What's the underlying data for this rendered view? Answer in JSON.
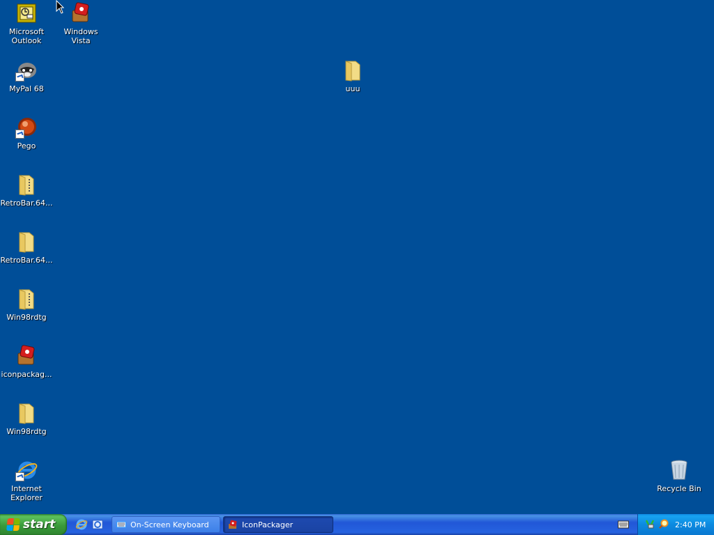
{
  "desktop": {
    "background_color": "#004e98",
    "icons": [
      {
        "label": "Microsoft Outlook",
        "icon": "outlook-icon"
      },
      {
        "label": "Windows Vista",
        "icon": "iconpackager-icon"
      },
      {
        "label": "MyPal 68",
        "icon": "mypal-icon"
      },
      {
        "label": "uuu",
        "icon": "folder-icon"
      },
      {
        "label": "Pego",
        "icon": "pego-icon"
      },
      {
        "label": "RetroBar.64...",
        "icon": "zip-folder-icon"
      },
      {
        "label": "RetroBar.64...",
        "icon": "folder-icon"
      },
      {
        "label": "Win98rdtg",
        "icon": "zip-folder-icon"
      },
      {
        "label": "iconpackag...",
        "icon": "iconpackager-icon"
      },
      {
        "label": "Win98rdtg",
        "icon": "folder-icon"
      },
      {
        "label": "Internet Explorer",
        "icon": "internet-explorer-icon"
      },
      {
        "label": "Recycle Bin",
        "icon": "recycle-bin-icon"
      }
    ]
  },
  "taskbar": {
    "start_label": "start",
    "quick_launch": [
      "internet-explorer-icon",
      "outlook-express-icon"
    ],
    "tasks": [
      {
        "label": "On-Screen Keyboard",
        "icon": "keyboard-icon",
        "active": false
      },
      {
        "label": "IconPackager",
        "icon": "iconpackager-icon",
        "active": true
      }
    ],
    "tray": {
      "icons": [
        "network-icon",
        "search-icon"
      ],
      "clock": "2:40 PM"
    }
  }
}
